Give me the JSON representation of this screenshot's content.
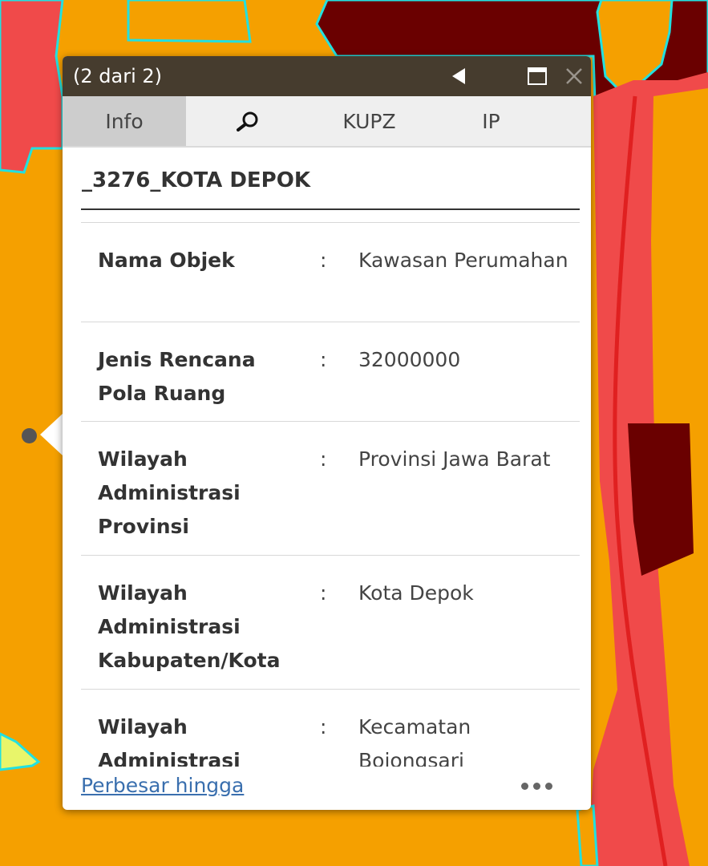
{
  "colors": {
    "map_orange": "#f5a000",
    "map_red": "#f04a4a",
    "map_dark_red": "#6a0000",
    "map_cyan": "#22e0e0",
    "map_yellow": "#e8f56a",
    "title_bar": "#463c2e",
    "link": "#3a6fae"
  },
  "popup": {
    "title": "(2 dari 2)",
    "icons": {
      "prev": "triangle-left-icon",
      "maximize": "maximize-icon",
      "close": "close-icon"
    },
    "tabs": [
      {
        "label": "Info",
        "active": true
      },
      {
        "label": "",
        "icon": "search-icon",
        "active": false
      },
      {
        "label": "KUPZ",
        "active": false
      },
      {
        "label": "IP",
        "active": false
      }
    ],
    "layer_title": "_3276_KOTA DEPOK",
    "attributes": [
      {
        "key": "Nama Objek",
        "value": "Kawasan Perumahan"
      },
      {
        "key": "Jenis Rencana Pola Ruang",
        "value": "32000000"
      },
      {
        "key": "Wilayah Administrasi Provinsi",
        "value": "Provinsi Jawa Barat"
      },
      {
        "key": "Wilayah Administrasi Kabupaten/Kota",
        "value": "Kota Depok"
      },
      {
        "key": "Wilayah Administrasi",
        "value": "Kecamatan Bojongsari"
      }
    ],
    "separator": ":",
    "footer_link": "Perbesar hingga",
    "more_icon": "more-dots-icon"
  }
}
